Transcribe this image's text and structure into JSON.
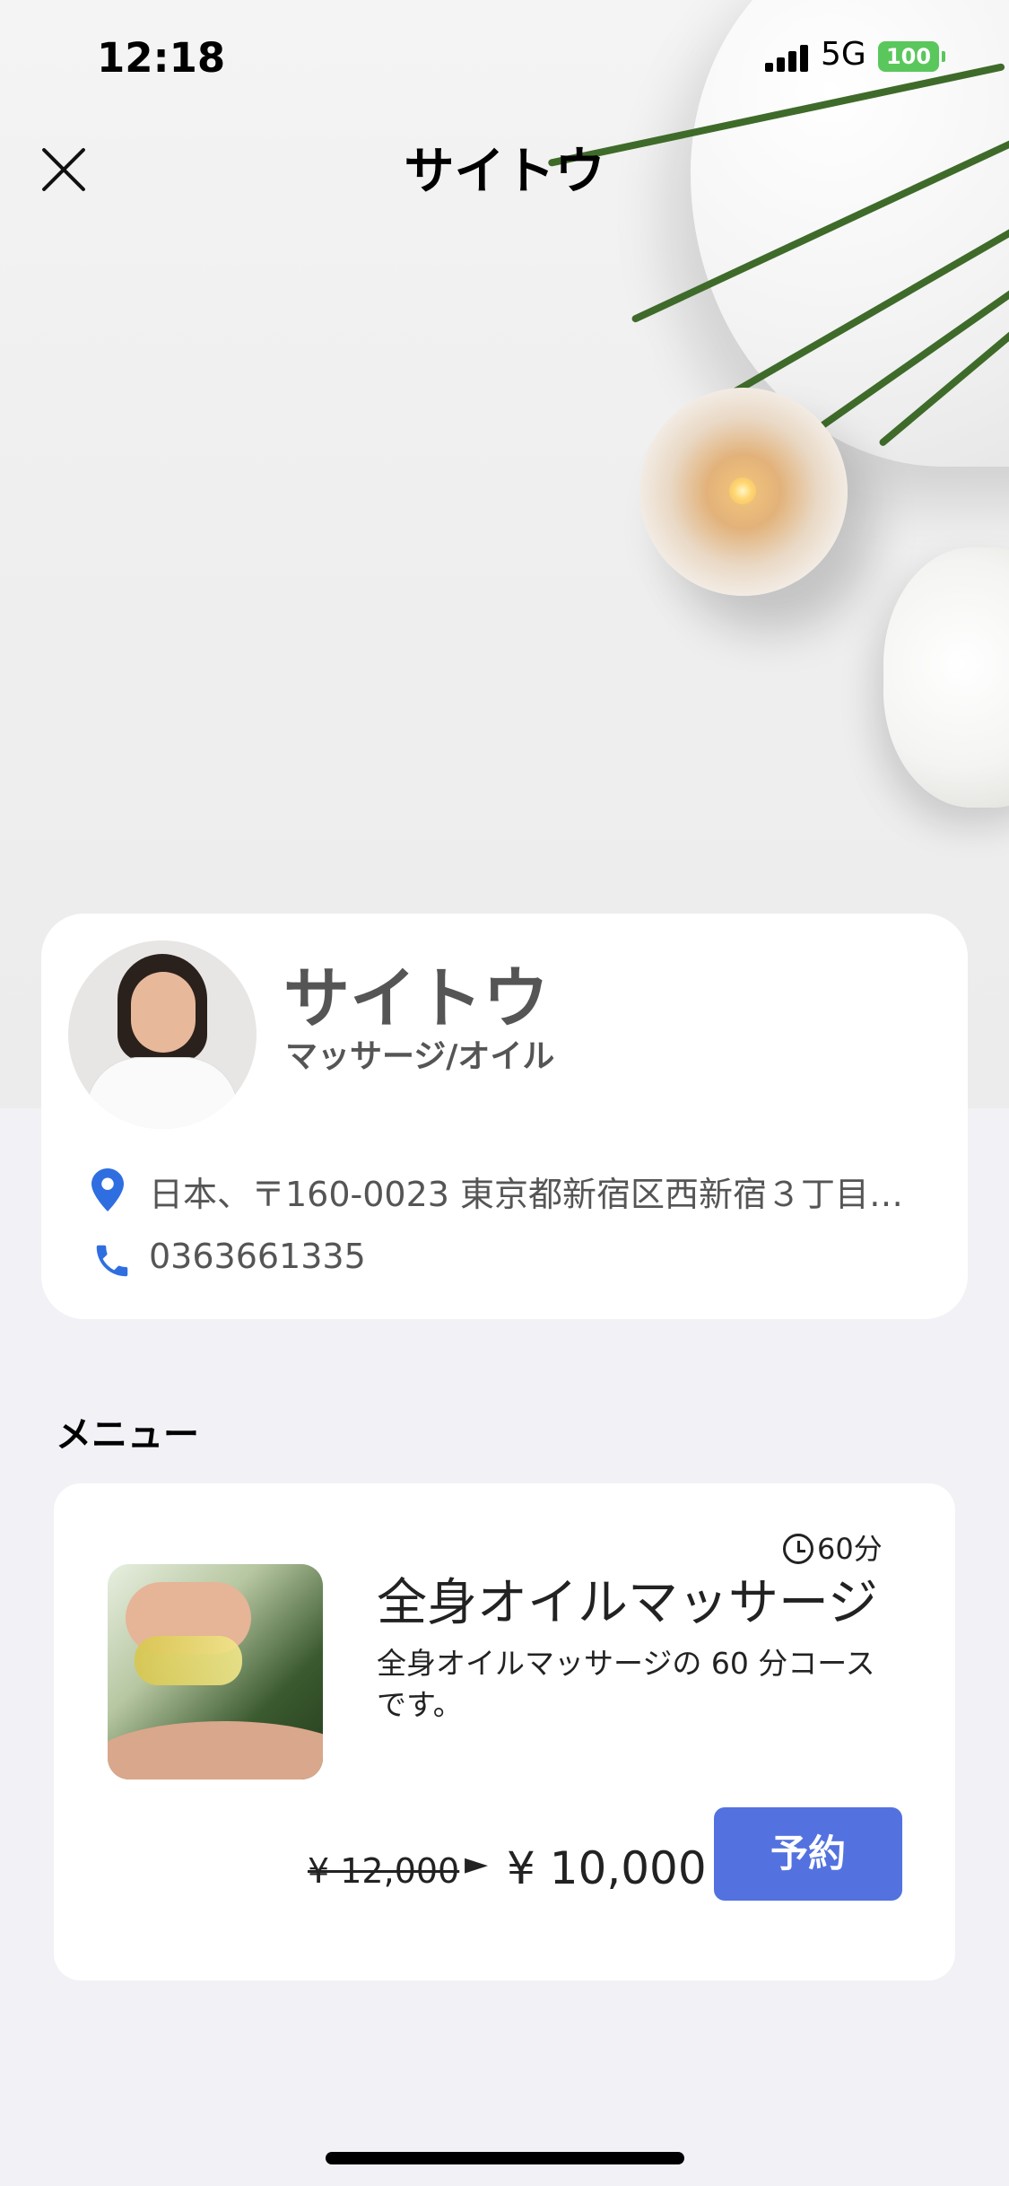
{
  "status_bar": {
    "time": "12:18",
    "network": "5G",
    "battery": "100"
  },
  "header": {
    "title": "サイトウ"
  },
  "profile": {
    "name": "サイトウ",
    "category": "マッサージ/オイル",
    "address": "日本、〒160-0023 東京都新宿区西新宿３丁目…",
    "phone": "0363661335"
  },
  "menu_section": {
    "title": "メニュー"
  },
  "menu_items": [
    {
      "duration": "60分",
      "title": "全身オイルマッサージ",
      "description": "全身オイルマッサージの 60 分コースです。",
      "old_price": "¥ 12,000",
      "arrow": "►",
      "new_price": "¥ 10,000",
      "reserve_label": "予約"
    }
  ],
  "icons": {
    "close": "close-icon",
    "pin": "location-pin-icon",
    "phone": "phone-icon",
    "clock": "clock-icon"
  },
  "colors": {
    "accent": "#5372e0",
    "icon_blue": "#2f6ee0",
    "battery": "#5ac75c"
  }
}
